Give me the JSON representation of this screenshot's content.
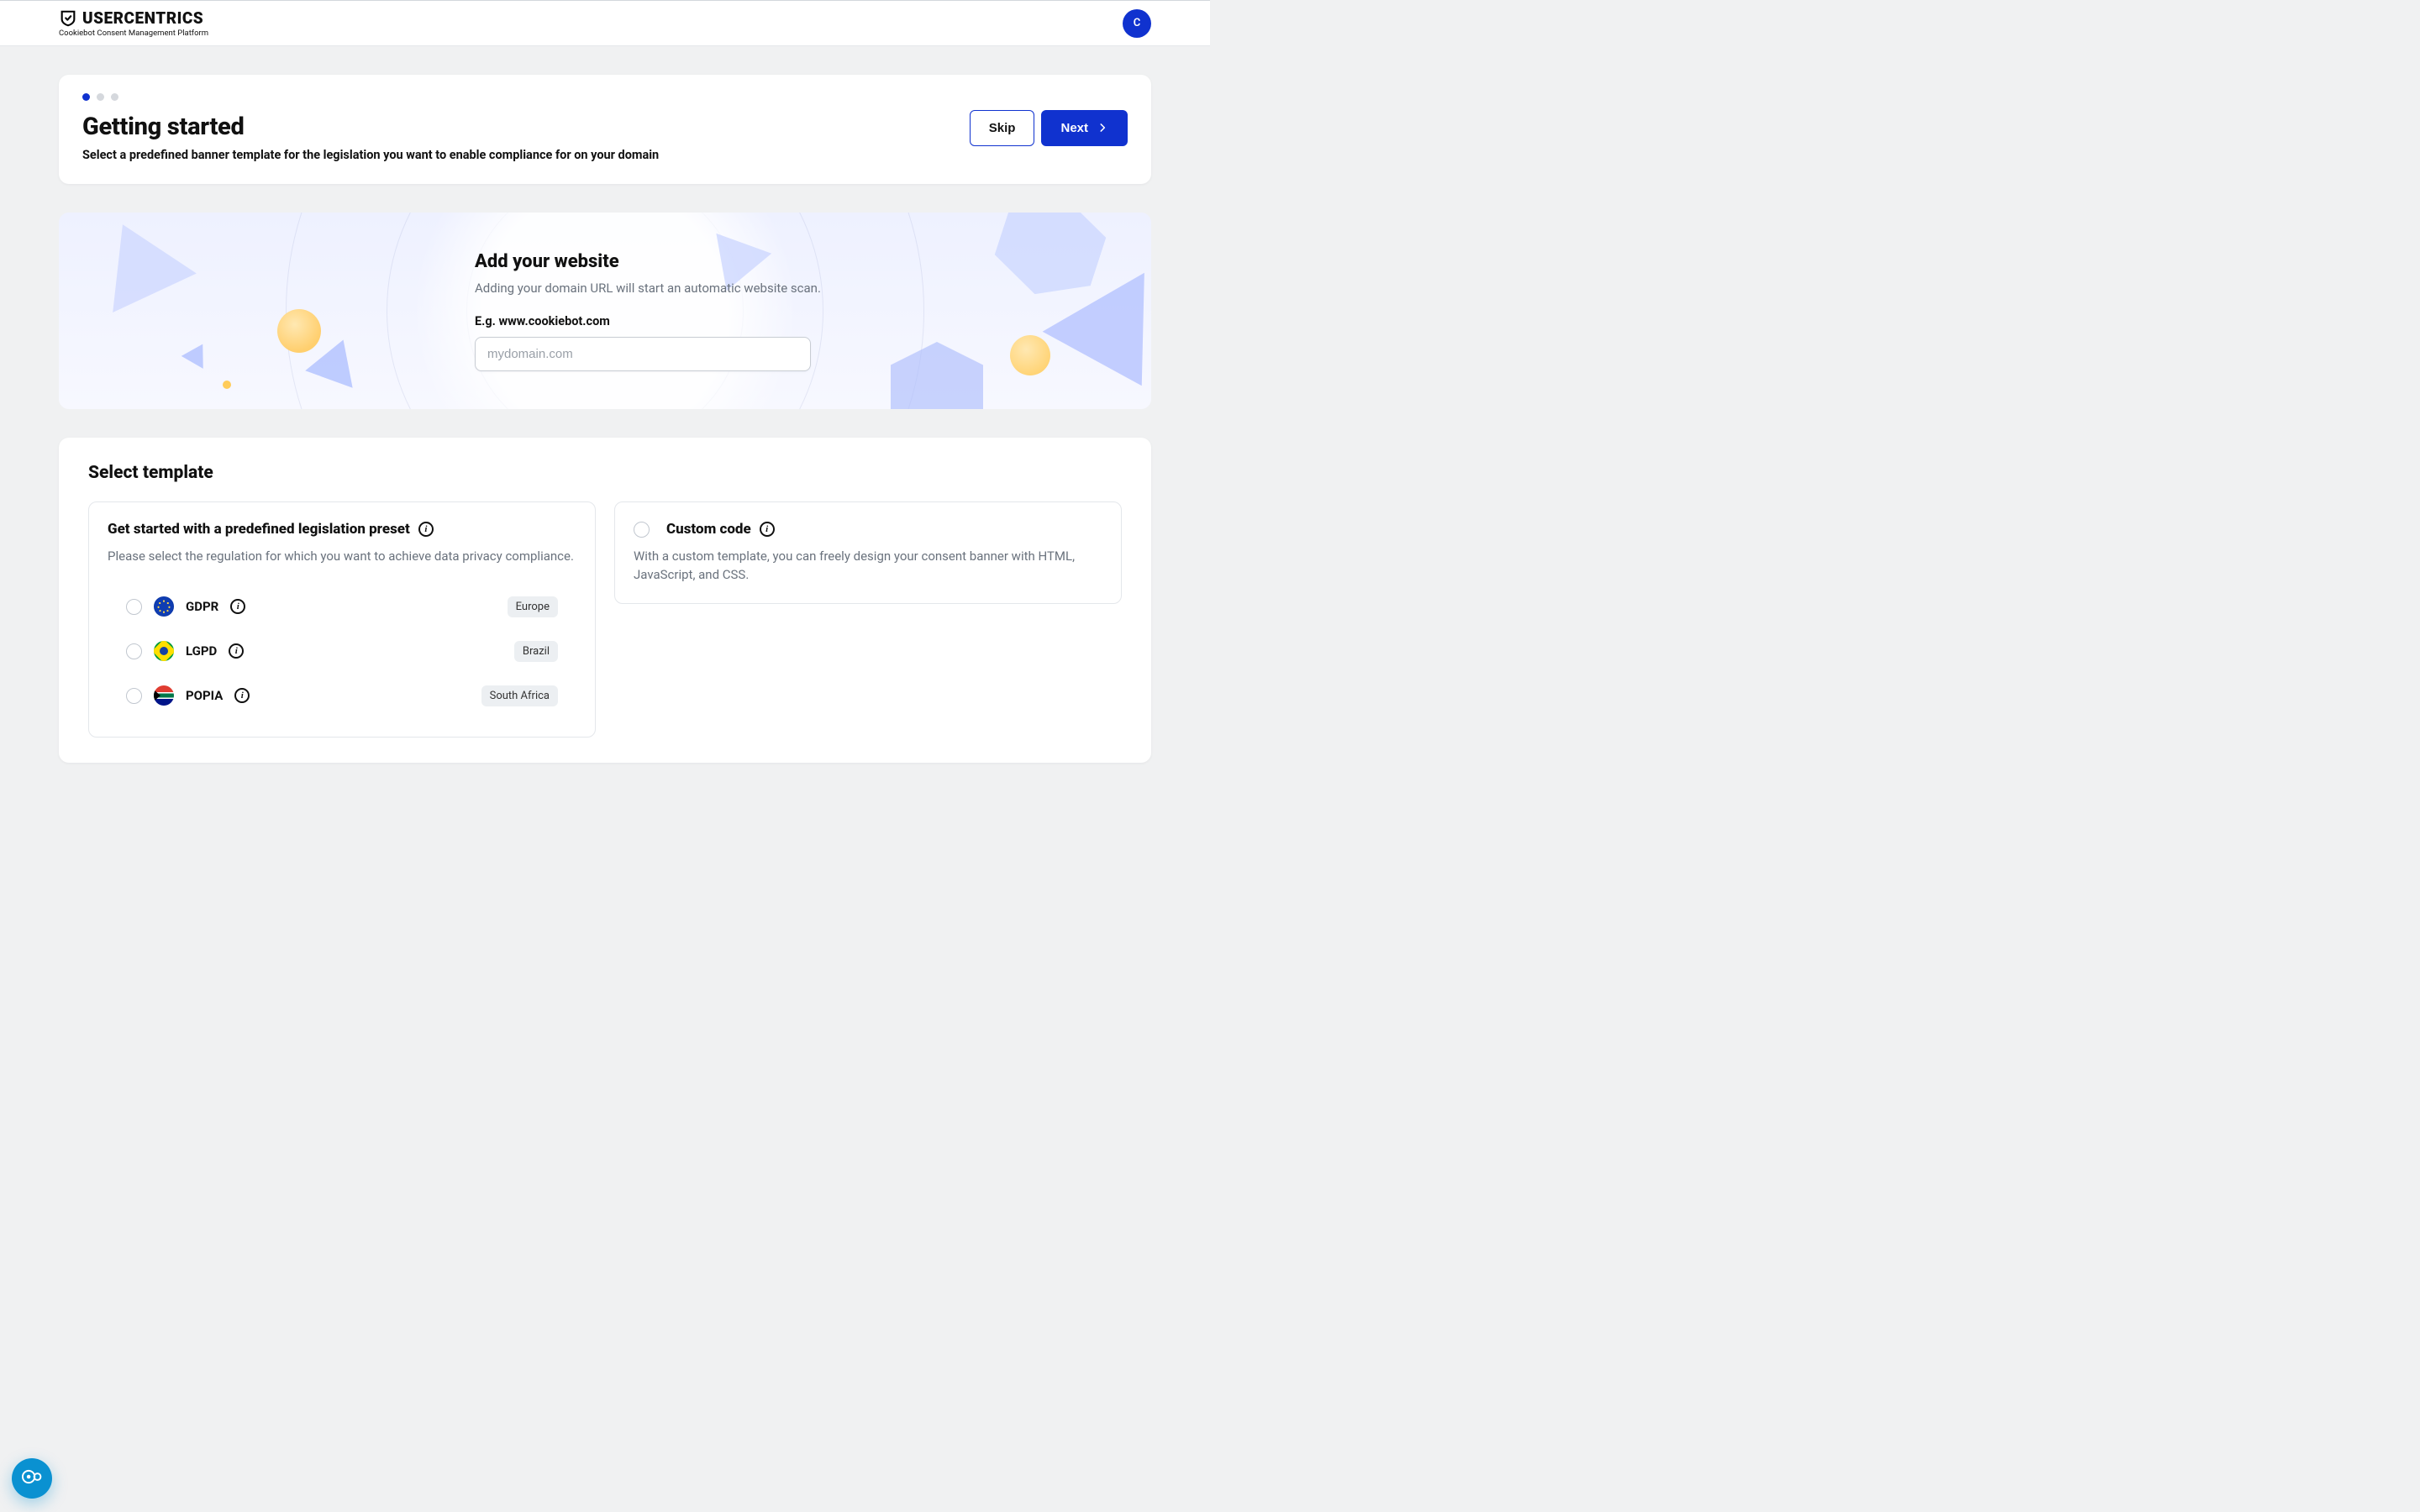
{
  "header": {
    "brand_word": "USERCENTRICS",
    "brand_sub": "Cookiebot Consent Management Platform",
    "avatar_letter": "C"
  },
  "wizard": {
    "title": "Getting started",
    "subtitle": "Select a predefined banner template for the legislation you want to enable compliance for on your domain",
    "skip_label": "Skip",
    "next_label": "Next",
    "step_active_index": 0,
    "step_count": 3
  },
  "hero": {
    "title": "Add your website",
    "subtitle": "Adding your domain URL will start an automatic website scan.",
    "input_label": "E.g. www.cookiebot.com",
    "input_placeholder": "mydomain.com",
    "input_value": ""
  },
  "templates": {
    "section_title": "Select template",
    "preset_panel": {
      "title": "Get started with a predefined legislation preset",
      "desc": "Please select the regulation for which you want to achieve data privacy compliance.",
      "items": [
        {
          "id": "gdpr",
          "name": "GDPR",
          "region": "Europe"
        },
        {
          "id": "lgpd",
          "name": "LGPD",
          "region": "Brazil"
        },
        {
          "id": "popia",
          "name": "POPIA",
          "region": "South Africa"
        }
      ]
    },
    "custom_panel": {
      "title": "Custom code",
      "desc": "With a custom template, you can freely design your consent banner with HTML, JavaScript, and CSS."
    }
  }
}
